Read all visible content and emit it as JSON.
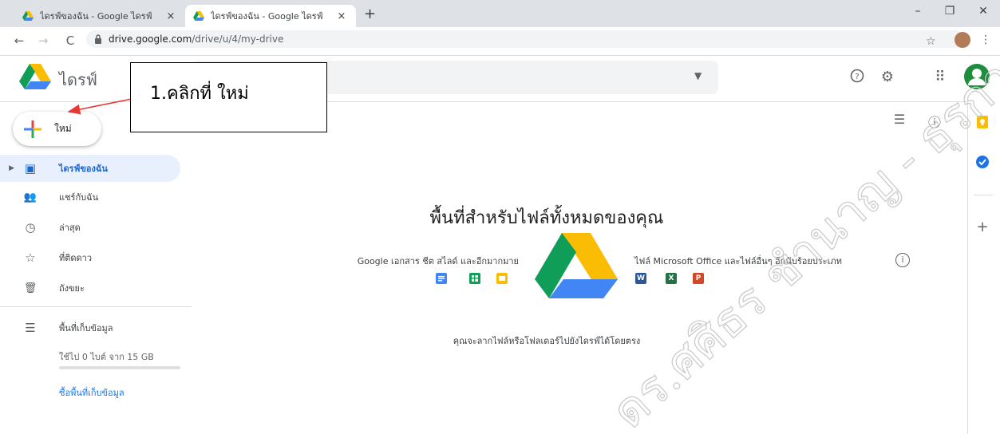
{
  "browser": {
    "tabs": [
      {
        "title": "ไดรฟ์ของฉัน - Google ไดรฟ์",
        "close": "×"
      },
      {
        "title": "ไดรฟ์ของฉัน - Google ไดรฟ์",
        "close": "×"
      }
    ],
    "new_tab": "+",
    "window_controls": {
      "minimize": "–",
      "restore": "❐",
      "close": "✕"
    },
    "nav": {
      "back": "←",
      "forward": "→",
      "reload": "C"
    },
    "url_host": "drive.google.com",
    "url_path": "/drive/u/4/my-drive",
    "bookmark": "☆",
    "menu": "⋮"
  },
  "header": {
    "app_name": "ไดรฟ์",
    "search_dropdown": "▼",
    "help": "?",
    "settings": "⚙",
    "apps": "⠿"
  },
  "annotation": {
    "text": "1.คลิกที่ ใหม่"
  },
  "new_button": {
    "label": "ใหม่"
  },
  "toolbar": {
    "list_view": "☰",
    "details": "ⓘ"
  },
  "sidebar": {
    "items": [
      {
        "label": "ไดรฟ์ของฉัน",
        "icon": "drive-icon",
        "glyph": "▣",
        "caret": "▶"
      },
      {
        "label": "แชร์กับฉัน",
        "icon": "people-icon",
        "glyph": "👥"
      },
      {
        "label": "ล่าสุด",
        "icon": "clock-icon",
        "glyph": "◷"
      },
      {
        "label": "ที่ติดดาว",
        "icon": "star-icon",
        "glyph": "☆"
      },
      {
        "label": "ถังขยะ",
        "icon": "trash-icon",
        "glyph": "🗑"
      }
    ],
    "storage": {
      "label": "พื้นที่เก็บข้อมูล",
      "glyph": "☰",
      "used": "ใช้ไป 0 ไบต์ จาก 15 GB",
      "used_fraction": 0.0
    },
    "buy_storage": "ซื้อพื้นที่เก็บข้อมูล"
  },
  "side_panel": {
    "add": "+"
  },
  "empty_state": {
    "title": "พื้นที่สำหรับไฟล์ทั้งหมดของคุณ",
    "left_caption": "Google เอกสาร ชีต สไลด์ และอีกมากมาย",
    "right_caption": "ไฟล์ Microsoft Office และไฟล์อื่นๆ อีกนับร้อยประเภท",
    "info": "i",
    "ms_icons": {
      "word": "W",
      "excel": "X",
      "powerpoint": "P"
    },
    "drag_hint": "คุณจะลากไฟล์หรือโฟลเดอร์ไปยังไดรฟ์ได้โดยตรง"
  },
  "watermark": {
    "text": "ดร.ศศิธร ชำนาญ - ธุรการ มพ."
  },
  "colors": {
    "accent": "#1a73e8",
    "active_bg": "#e8f0fe",
    "word": "#2b579a",
    "excel": "#217346",
    "powerpoint": "#d24726"
  }
}
